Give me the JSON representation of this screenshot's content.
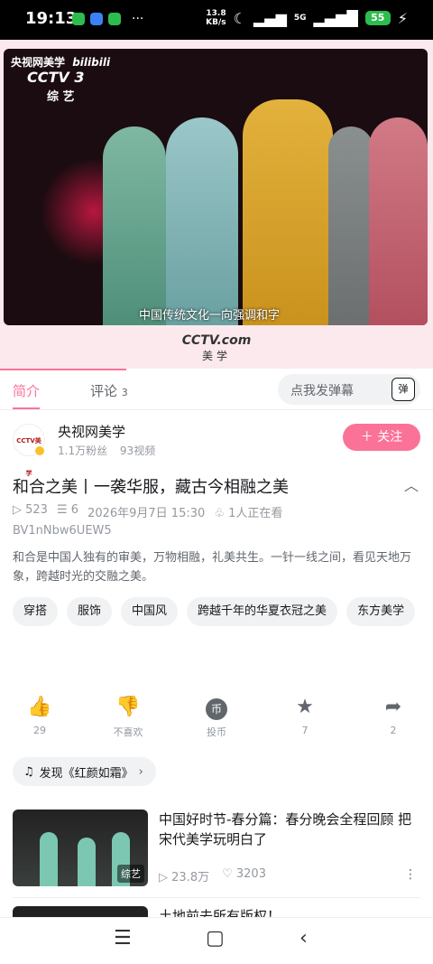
{
  "status_bar": {
    "time": "19:13",
    "speed_value": "13.8",
    "speed_unit": "KB/s",
    "network": "5G",
    "battery": "55",
    "app_icon_colors": [
      "#2dbd4e",
      "#3b82f6",
      "#2dbd4e"
    ]
  },
  "video": {
    "watermark_channel": "央视网美学",
    "watermark_site": "bilibili",
    "logo": "CCTV 3",
    "logo_sub": "综 艺",
    "subtitle": "中国传统文化一向强调和字",
    "footer_logo": "CCTV.com",
    "footer_name": "美学"
  },
  "tabs": {
    "intro": "简介",
    "comments_label": "评论",
    "comments_count": "3",
    "danmu_placeholder": "点我发弹幕",
    "danmu_icon": "弹"
  },
  "uploader": {
    "name": "央视网美学",
    "fans": "1.1万粉丝",
    "videos": "93视频",
    "follow_label": "关注",
    "avatar_text": "CCTV美学"
  },
  "video_info": {
    "title": "和合之美丨一袭华服，藏古今相融之美",
    "views": "523",
    "danmaku": "6",
    "date": "2026年9月7日 15:30",
    "watching": "1人正在看",
    "bvid": "BV1nNbw6UEW5",
    "description": "和合是中国人独有的审美，万物相融，礼美共生。一针一线之间，看见天地万象，跨越时光的交融之美。"
  },
  "tags": [
    "穿搭",
    "服饰",
    "中国风",
    "跨越千年的华夏衣冠之美",
    "东方美学"
  ],
  "actions": [
    {
      "name": "like",
      "icon": "thumbs-up-icon",
      "glyph": "👍",
      "label": "29"
    },
    {
      "name": "dislike",
      "icon": "thumbs-down-icon",
      "glyph": "👎",
      "label": "不喜欢"
    },
    {
      "name": "coin",
      "icon": "coin-icon",
      "glyph": "币",
      "label": "投币"
    },
    {
      "name": "favorite",
      "icon": "star-icon",
      "glyph": "★",
      "label": "7"
    },
    {
      "name": "share",
      "icon": "share-icon",
      "glyph": "➦",
      "label": "2"
    }
  ],
  "music": {
    "label": "发现《红颜如霜》"
  },
  "recommended": [
    {
      "title": "中国好时节-春分篇：春分晚会全程回顾 把宋代美学玩明白了",
      "badge": "综艺",
      "views": "23.8万",
      "likes": "3203"
    },
    {
      "title": "土地前去所有版权！"
    }
  ],
  "colors": {
    "accent": "#fb7299",
    "text": "#18191c",
    "muted": "#9499a0"
  }
}
